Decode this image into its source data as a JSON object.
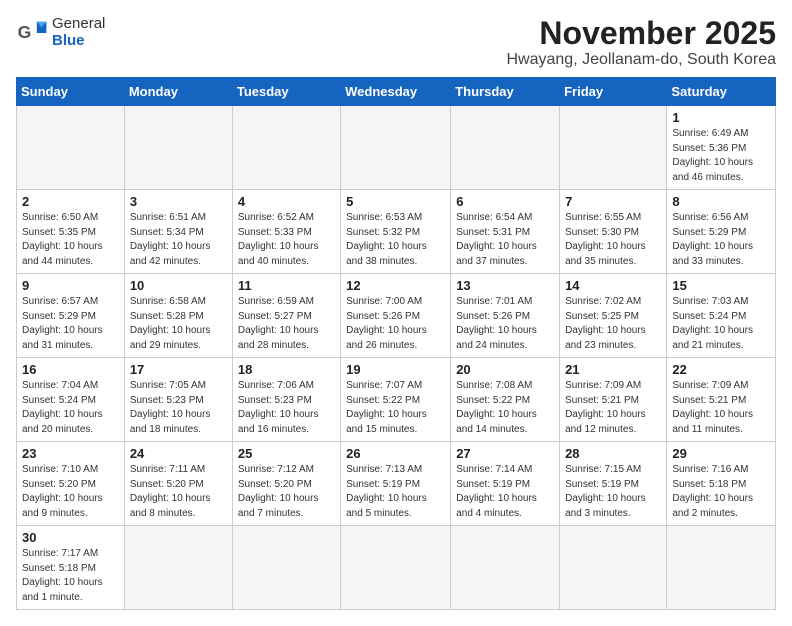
{
  "header": {
    "logo_general": "General",
    "logo_blue": "Blue",
    "month_title": "November 2025",
    "location": "Hwayang, Jeollanam-do, South Korea"
  },
  "weekdays": [
    "Sunday",
    "Monday",
    "Tuesday",
    "Wednesday",
    "Thursday",
    "Friday",
    "Saturday"
  ],
  "weeks": [
    [
      {
        "day": "",
        "info": ""
      },
      {
        "day": "",
        "info": ""
      },
      {
        "day": "",
        "info": ""
      },
      {
        "day": "",
        "info": ""
      },
      {
        "day": "",
        "info": ""
      },
      {
        "day": "",
        "info": ""
      },
      {
        "day": "1",
        "info": "Sunrise: 6:49 AM\nSunset: 5:36 PM\nDaylight: 10 hours\nand 46 minutes."
      }
    ],
    [
      {
        "day": "2",
        "info": "Sunrise: 6:50 AM\nSunset: 5:35 PM\nDaylight: 10 hours\nand 44 minutes."
      },
      {
        "day": "3",
        "info": "Sunrise: 6:51 AM\nSunset: 5:34 PM\nDaylight: 10 hours\nand 42 minutes."
      },
      {
        "day": "4",
        "info": "Sunrise: 6:52 AM\nSunset: 5:33 PM\nDaylight: 10 hours\nand 40 minutes."
      },
      {
        "day": "5",
        "info": "Sunrise: 6:53 AM\nSunset: 5:32 PM\nDaylight: 10 hours\nand 38 minutes."
      },
      {
        "day": "6",
        "info": "Sunrise: 6:54 AM\nSunset: 5:31 PM\nDaylight: 10 hours\nand 37 minutes."
      },
      {
        "day": "7",
        "info": "Sunrise: 6:55 AM\nSunset: 5:30 PM\nDaylight: 10 hours\nand 35 minutes."
      },
      {
        "day": "8",
        "info": "Sunrise: 6:56 AM\nSunset: 5:29 PM\nDaylight: 10 hours\nand 33 minutes."
      }
    ],
    [
      {
        "day": "9",
        "info": "Sunrise: 6:57 AM\nSunset: 5:29 PM\nDaylight: 10 hours\nand 31 minutes."
      },
      {
        "day": "10",
        "info": "Sunrise: 6:58 AM\nSunset: 5:28 PM\nDaylight: 10 hours\nand 29 minutes."
      },
      {
        "day": "11",
        "info": "Sunrise: 6:59 AM\nSunset: 5:27 PM\nDaylight: 10 hours\nand 28 minutes."
      },
      {
        "day": "12",
        "info": "Sunrise: 7:00 AM\nSunset: 5:26 PM\nDaylight: 10 hours\nand 26 minutes."
      },
      {
        "day": "13",
        "info": "Sunrise: 7:01 AM\nSunset: 5:26 PM\nDaylight: 10 hours\nand 24 minutes."
      },
      {
        "day": "14",
        "info": "Sunrise: 7:02 AM\nSunset: 5:25 PM\nDaylight: 10 hours\nand 23 minutes."
      },
      {
        "day": "15",
        "info": "Sunrise: 7:03 AM\nSunset: 5:24 PM\nDaylight: 10 hours\nand 21 minutes."
      }
    ],
    [
      {
        "day": "16",
        "info": "Sunrise: 7:04 AM\nSunset: 5:24 PM\nDaylight: 10 hours\nand 20 minutes."
      },
      {
        "day": "17",
        "info": "Sunrise: 7:05 AM\nSunset: 5:23 PM\nDaylight: 10 hours\nand 18 minutes."
      },
      {
        "day": "18",
        "info": "Sunrise: 7:06 AM\nSunset: 5:23 PM\nDaylight: 10 hours\nand 16 minutes."
      },
      {
        "day": "19",
        "info": "Sunrise: 7:07 AM\nSunset: 5:22 PM\nDaylight: 10 hours\nand 15 minutes."
      },
      {
        "day": "20",
        "info": "Sunrise: 7:08 AM\nSunset: 5:22 PM\nDaylight: 10 hours\nand 14 minutes."
      },
      {
        "day": "21",
        "info": "Sunrise: 7:09 AM\nSunset: 5:21 PM\nDaylight: 10 hours\nand 12 minutes."
      },
      {
        "day": "22",
        "info": "Sunrise: 7:09 AM\nSunset: 5:21 PM\nDaylight: 10 hours\nand 11 minutes."
      }
    ],
    [
      {
        "day": "23",
        "info": "Sunrise: 7:10 AM\nSunset: 5:20 PM\nDaylight: 10 hours\nand 9 minutes."
      },
      {
        "day": "24",
        "info": "Sunrise: 7:11 AM\nSunset: 5:20 PM\nDaylight: 10 hours\nand 8 minutes."
      },
      {
        "day": "25",
        "info": "Sunrise: 7:12 AM\nSunset: 5:20 PM\nDaylight: 10 hours\nand 7 minutes."
      },
      {
        "day": "26",
        "info": "Sunrise: 7:13 AM\nSunset: 5:19 PM\nDaylight: 10 hours\nand 5 minutes."
      },
      {
        "day": "27",
        "info": "Sunrise: 7:14 AM\nSunset: 5:19 PM\nDaylight: 10 hours\nand 4 minutes."
      },
      {
        "day": "28",
        "info": "Sunrise: 7:15 AM\nSunset: 5:19 PM\nDaylight: 10 hours\nand 3 minutes."
      },
      {
        "day": "29",
        "info": "Sunrise: 7:16 AM\nSunset: 5:18 PM\nDaylight: 10 hours\nand 2 minutes."
      }
    ],
    [
      {
        "day": "30",
        "info": "Sunrise: 7:17 AM\nSunset: 5:18 PM\nDaylight: 10 hours\nand 1 minute."
      },
      {
        "day": "",
        "info": ""
      },
      {
        "day": "",
        "info": ""
      },
      {
        "day": "",
        "info": ""
      },
      {
        "day": "",
        "info": ""
      },
      {
        "day": "",
        "info": ""
      },
      {
        "day": "",
        "info": ""
      }
    ]
  ]
}
